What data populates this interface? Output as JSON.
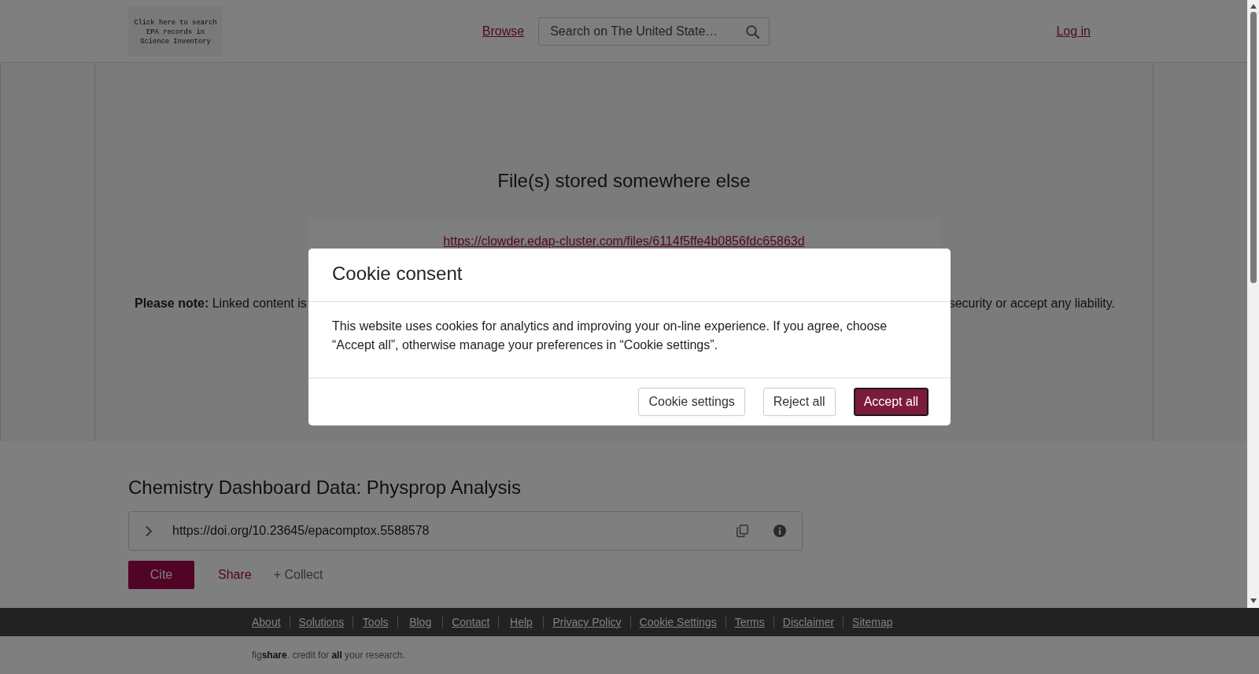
{
  "header": {
    "logo_lines": [
      "Click here to search",
      "EPA records in",
      "Science Inventory"
    ],
    "nav_link": "Browse",
    "search": {
      "placeholder": "Search on The United State…"
    },
    "login_link": "Log in"
  },
  "viewer": {
    "heading": "File(s) stored somewhere else",
    "link": "https://clowder.edap-cluster.com/files/6114f5ffe4b0856fdc65863d",
    "note_start": "**Please note:** Linked content is",
    "note_end": "security or accept any liability."
  },
  "item": {
    "title": "Chemistry Dashboard Data: Physprop Analysis",
    "doi": {
      "url": "https://doi.org/10.23645/epacomptox.5588578",
      "expanded": false
    },
    "actions": [
      {
        "kind": "primary",
        "label": "Cite"
      },
      {
        "kind": "link",
        "label": "Share"
      },
      {
        "kind": "muted",
        "label": "+ Collect"
      }
    ]
  },
  "footer": {
    "links": [
      "About",
      "Solutions",
      "Tools",
      "Blog",
      "Contact",
      "Help",
      "Privacy Policy",
      "Cookie Settings",
      "Terms",
      "Disclaimer",
      "Sitemap"
    ],
    "tagline": "fig**share**. credit for **all** your research."
  },
  "cookie_dialog": {
    "title": "Cookie consent",
    "text": "This website uses cookies for analytics and improving your on-line experience. If you agree, choose “Accept all”, otherwise manage your preferences in “Cookie settings”.",
    "buttons": [
      {
        "kind": "outline",
        "label": "Cookie settings",
        "focused": false
      },
      {
        "kind": "outline",
        "label": "Reject all",
        "focused": false
      },
      {
        "kind": "primary",
        "label": "Accept all",
        "focused": true
      }
    ]
  }
}
